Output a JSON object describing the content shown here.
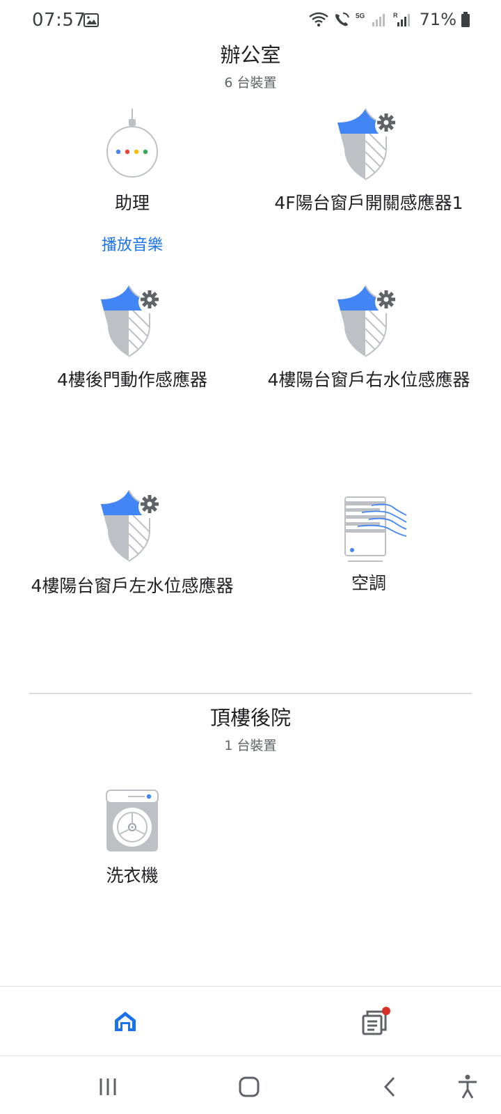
{
  "status": {
    "time": "07:57",
    "battery": "71%",
    "network_5g": "5G",
    "roaming": "R"
  },
  "sections": [
    {
      "title": "辦公室",
      "count": "6 台裝置",
      "devices": [
        {
          "label": "助理",
          "action": "播放音樂",
          "icon": "speaker-icon"
        },
        {
          "label": "4F陽台窗戶開關感應器1",
          "icon": "security-sensor-icon"
        },
        {
          "label": "4樓後門動作感應器",
          "icon": "security-sensor-icon"
        },
        {
          "label": "4樓陽台窗戶右水位感應器",
          "icon": "security-sensor-icon"
        },
        {
          "label": "4樓陽台窗戶左水位感應器",
          "icon": "security-sensor-icon"
        },
        {
          "label": "空調",
          "icon": "air-conditioner-icon"
        }
      ]
    },
    {
      "title": "頂樓後院",
      "count": "1 台裝置",
      "devices": [
        {
          "label": "洗衣機",
          "icon": "washer-icon"
        }
      ]
    }
  ],
  "tabs": [
    {
      "name": "home",
      "icon": "home-icon",
      "active": true
    },
    {
      "name": "feed",
      "icon": "feed-icon",
      "badge": true
    }
  ],
  "colors": {
    "accent": "#1a73e8",
    "shield_blue": "#4285f4",
    "shield_grey": "#bdc1c6",
    "badge_red": "#d93025"
  }
}
